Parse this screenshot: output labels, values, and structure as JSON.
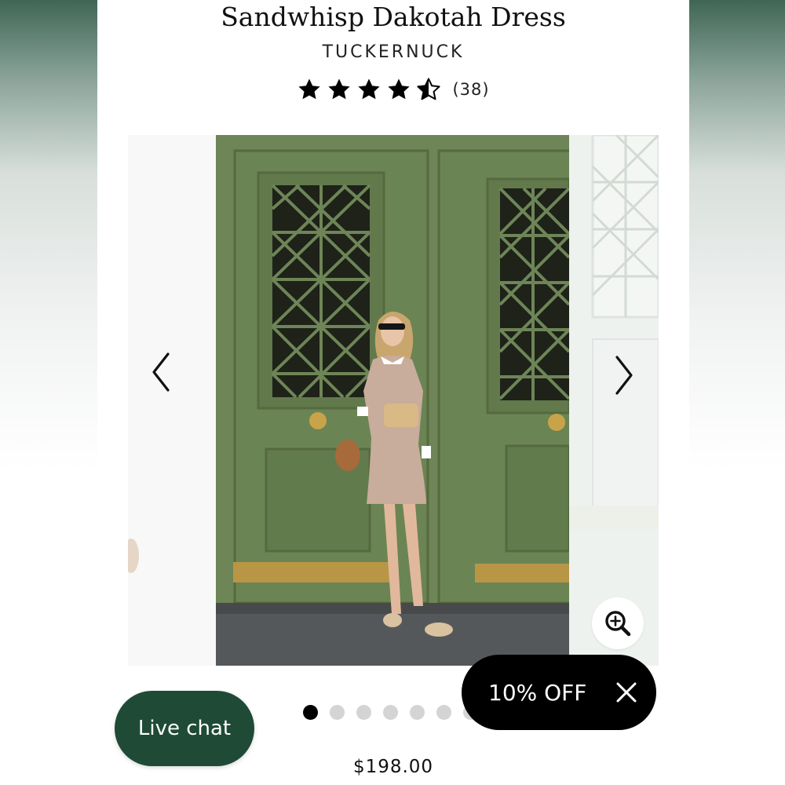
{
  "product": {
    "title": "Sandwhisp Dakotah Dress",
    "brand": "TUCKERNUCK",
    "rating": 4.5,
    "review_count": "(38)",
    "price": "$198.00"
  },
  "gallery": {
    "image_count": 7,
    "current_index": 0,
    "icons": {
      "prev": "chevron-left-icon",
      "next": "chevron-right-icon",
      "zoom": "zoom-in-icon"
    }
  },
  "live_chat": {
    "label": "Live chat"
  },
  "promo": {
    "label": "10% OFF",
    "close_icon": "close-icon"
  },
  "colors": {
    "live_chat_bg": "#1f4b36",
    "promo_bg": "#000000",
    "door_green": "#6b8455"
  }
}
